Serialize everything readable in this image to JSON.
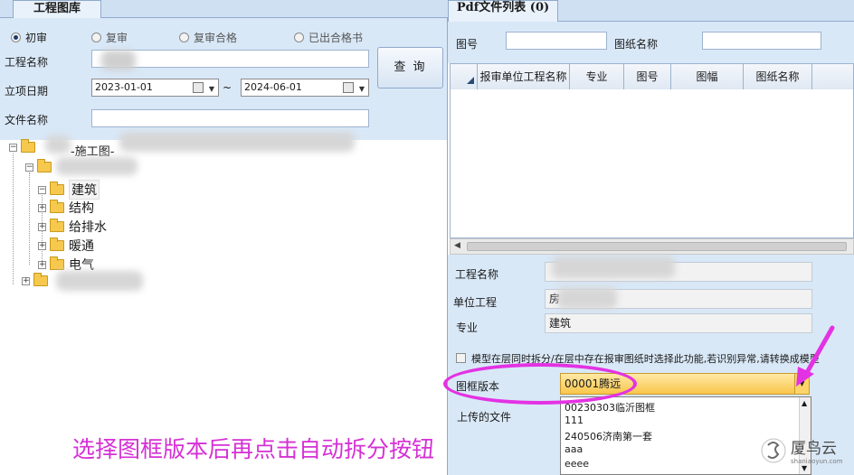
{
  "left": {
    "tab": "工程图库",
    "radios": [
      "初审",
      "复审",
      "复审合格",
      "已出合格书"
    ],
    "project_name_label": "工程名称",
    "setup_date_label": "立项日期",
    "date_from": "2023-01-01",
    "date_to": "2024-06-01",
    "date_sep": "~",
    "file_name_label": "文件名称",
    "query_button": "查 询"
  },
  "tree": {
    "root_label": "-施工图-",
    "children": [
      "建筑",
      "结构",
      "给排水",
      "暖通",
      "电气"
    ]
  },
  "right": {
    "tab": "Pdf文件列表 (0)",
    "drawing_no_label": "图号",
    "drawing_name_label": "图纸名称",
    "columns": [
      "报审单位工程名称",
      "专业",
      "图号",
      "图幅",
      "图纸名称"
    ],
    "project_name_label": "工程名称",
    "unit_project_label": "单位工程",
    "unit_project_value": "房",
    "specialty_label": "专业",
    "specialty_value": "建筑",
    "checkbox_text": "模型在层同时拆分/在层中存在报审图纸时选择此功能,若识别异常,请转换成模型",
    "frame_version_label": "图框版本",
    "frame_version_value": "00001腾远",
    "uploaded_files_label": "上传的文件",
    "dropdown_options": [
      "00230303临沂图框",
      "111",
      "240506济南第一套",
      "aaa",
      "eeee"
    ]
  },
  "annotation": {
    "instruction": "选择图框版本后再点击自动拆分按钮"
  },
  "watermark": {
    "brand": "厦鸟云",
    "url": "shaniaoyun.com"
  },
  "colors": {
    "panel_bg": "#d9e8f7",
    "annotation": "#e332e3",
    "combo_highlight": "#f9c64a"
  }
}
